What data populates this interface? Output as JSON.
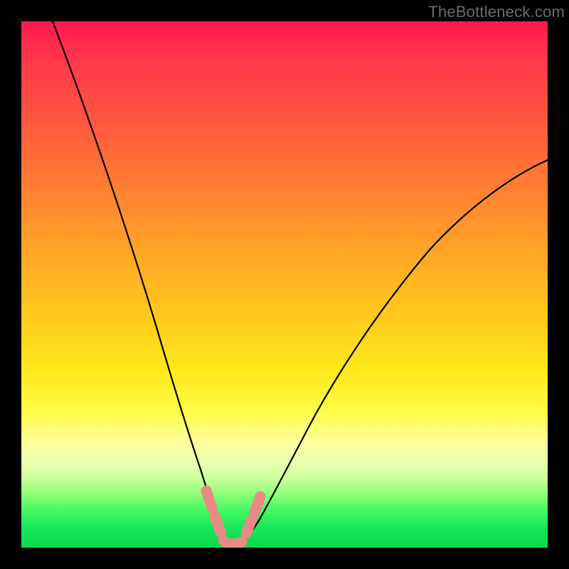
{
  "watermark": "TheBottleneck.com",
  "colors": {
    "background_frame": "#000000",
    "watermark": "#6a6a6a",
    "curve": "#000000",
    "salmon_overlay": "#e98b84",
    "gradient_top": "#ff1a4f",
    "gradient_bottom": "#0ad852"
  },
  "chart_data": {
    "type": "line",
    "title": "",
    "xlabel": "",
    "ylabel": "",
    "xlim": [
      0,
      100
    ],
    "ylim": [
      0,
      100
    ],
    "grid": false,
    "legend": false,
    "background": "heatmap-gradient vertical (red top → green bottom)",
    "series": [
      {
        "name": "left-branch",
        "x": [
          6,
          10,
          14,
          18,
          22,
          25,
          27,
          29,
          31,
          33,
          35,
          36,
          37,
          38
        ],
        "y": [
          100,
          88,
          76,
          64,
          51,
          40,
          32,
          24,
          17,
          11,
          6,
          3.5,
          1.5,
          0.5
        ]
      },
      {
        "name": "right-branch",
        "x": [
          40,
          42,
          45,
          49,
          54,
          60,
          67,
          75,
          84,
          93,
          100
        ],
        "y": [
          0.5,
          2,
          6,
          13,
          22,
          33,
          44,
          54,
          63,
          70,
          74
        ]
      },
      {
        "name": "valley-floor-highlight",
        "note": "salmon-colored beaded segment along base of V where the curve flattens",
        "x": [
          34,
          35,
          36,
          37,
          38,
          40,
          41,
          42,
          43,
          44
        ],
        "y": [
          8,
          5,
          3,
          1.5,
          0.8,
          0.8,
          1.5,
          3,
          5,
          8
        ]
      }
    ]
  }
}
